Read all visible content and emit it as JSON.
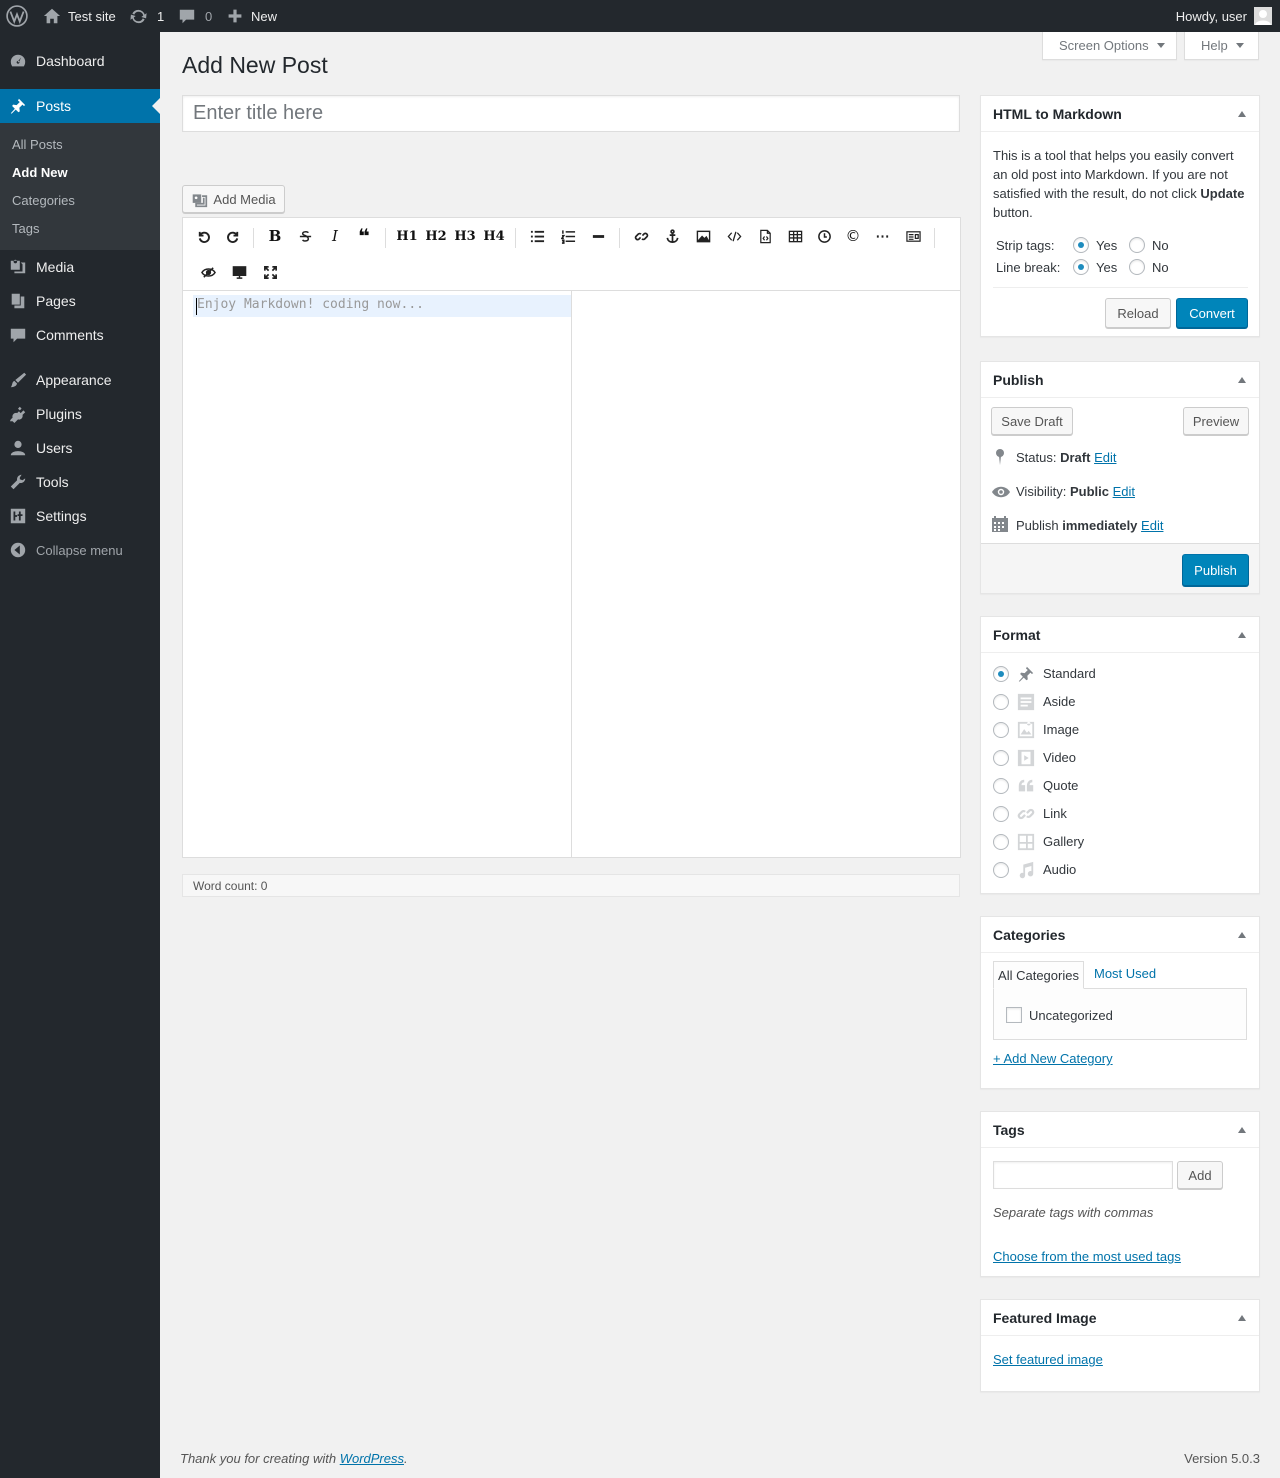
{
  "adminbar": {
    "site_name": "Test site",
    "updates_count": "1",
    "comments_count": "0",
    "new_label": "New",
    "howdy": "Howdy, user"
  },
  "sidebar": {
    "items": [
      {
        "label": "Dashboard",
        "icon": "dashboard-icon"
      },
      {
        "label": "Posts",
        "icon": "pin-icon"
      },
      {
        "label": "Media",
        "icon": "media-icon"
      },
      {
        "label": "Pages",
        "icon": "pages-icon"
      },
      {
        "label": "Comments",
        "icon": "comments-icon"
      },
      {
        "label": "Appearance",
        "icon": "brush-icon"
      },
      {
        "label": "Plugins",
        "icon": "plugin-icon"
      },
      {
        "label": "Users",
        "icon": "users-icon"
      },
      {
        "label": "Tools",
        "icon": "wrench-icon"
      },
      {
        "label": "Settings",
        "icon": "settings-icon"
      },
      {
        "label": "Collapse menu",
        "icon": "collapse-icon"
      }
    ],
    "submenu": [
      "All Posts",
      "Add New",
      "Categories",
      "Tags"
    ]
  },
  "screen_options": "Screen Options",
  "help": "Help",
  "page_title": "Add New Post",
  "title_placeholder": "Enter title here",
  "add_media": "Add Media",
  "toolbar": {
    "h1": "H1",
    "h2": "H2",
    "h3": "H3",
    "h4": "H4",
    "bold": "B",
    "italic": "I"
  },
  "editor_placeholder": "Enjoy Markdown! coding now...",
  "word_count": "Word count: 0",
  "h2m": {
    "title": "HTML to Markdown",
    "desc_1": "This is a tool that helps you easily convert an old post into Markdown. If you are not satisfied with the result, do not click",
    "desc_bold": "Update",
    "desc_2": "button.",
    "strip_tags": "Strip tags:",
    "line_break": "Line break:",
    "yes": "Yes",
    "no": "No",
    "reload": "Reload",
    "convert": "Convert"
  },
  "publish": {
    "title": "Publish",
    "save_draft": "Save Draft",
    "preview": "Preview",
    "status_label": "Status:",
    "status_value": "Draft",
    "visibility_label": "Visibility:",
    "visibility_value": "Public",
    "publish_label": "Publish",
    "publish_value": "immediately",
    "edit": "Edit",
    "publish_button": "Publish"
  },
  "format": {
    "title": "Format",
    "options": [
      "Standard",
      "Aside",
      "Image",
      "Video",
      "Quote",
      "Link",
      "Gallery",
      "Audio"
    ],
    "selected": "Standard"
  },
  "categories": {
    "title": "Categories",
    "tab_all": "All Categories",
    "tab_most": "Most Used",
    "items": [
      "Uncategorized"
    ],
    "add_new": "+ Add New Category"
  },
  "tags": {
    "title": "Tags",
    "add": "Add",
    "hint": "Separate tags with commas",
    "choose": "Choose from the most used tags"
  },
  "featured": {
    "title": "Featured Image",
    "set": "Set featured image"
  },
  "footer": {
    "thanks_prefix": "Thank you for creating with ",
    "thanks_link": "WordPress",
    "thanks_suffix": ".",
    "version": "Version 5.0.3"
  },
  "colors": {
    "admin_bar": "#23282d",
    "accent": "#0073aa",
    "primary_button": "#0085ba"
  }
}
